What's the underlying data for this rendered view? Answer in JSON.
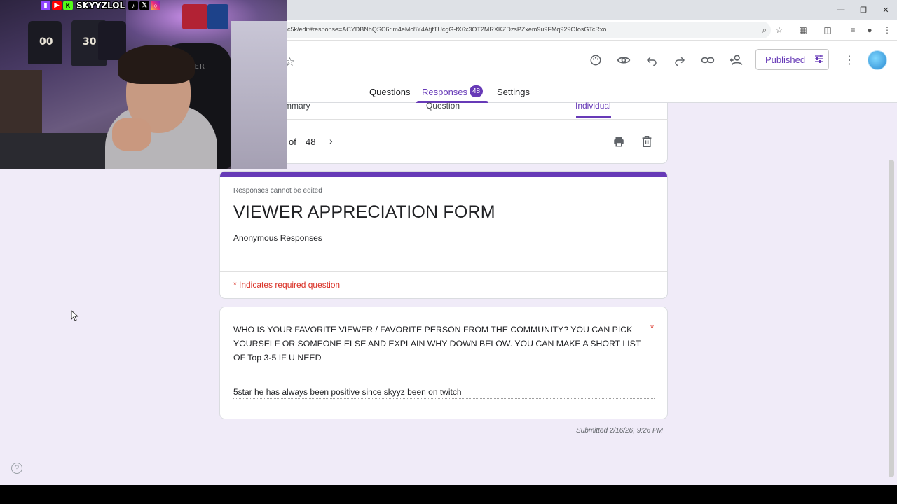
{
  "browser": {
    "url": "c5k/edit#response=ACYDBNhQSC6rlm4eMc8Y4AtjfTUcgG-fX6x3OT2MRXKZDzsPZxem9u9FMq929OIosGTcRxo"
  },
  "header": {
    "published_label": "Published"
  },
  "tabs": [
    {
      "label": "Questions"
    },
    {
      "label": "Responses",
      "badge": "48"
    },
    {
      "label": "Settings"
    }
  ],
  "subtabs": {
    "summary": "mmary",
    "question": "Question",
    "individual": "Individual"
  },
  "pager": {
    "of_label": "of",
    "total": "48"
  },
  "form": {
    "notice": "Responses cannot be edited",
    "title": "VIEWER APPRECIATION FORM",
    "description": "Anonymous Responses",
    "required_note": "* Indicates required question"
  },
  "question": {
    "text": "WHO IS YOUR FAVORITE VIEWER / FAVORITE PERSON FROM THE COMMUNITY? YOU CAN PICK YOURSELF OR SOMEONE ELSE AND EXPLAIN WHY DOWN BELOW. YOU CAN MAKE A SHORT LIST OF Top 3-5 IF U NEED",
    "required_mark": "*",
    "answer": "5star he has always been positive since skyyz been on twitch"
  },
  "submitted": "Submitted 2/16/26, 9:26 PM",
  "webcam": {
    "channel_name": "SKYYZLOL",
    "jersey_1": "00",
    "jersey_2": "30",
    "chair_brand": "ACER"
  },
  "colors": {
    "accent": "#673ab7",
    "background": "#f0ebf8",
    "required": "#d93025"
  }
}
